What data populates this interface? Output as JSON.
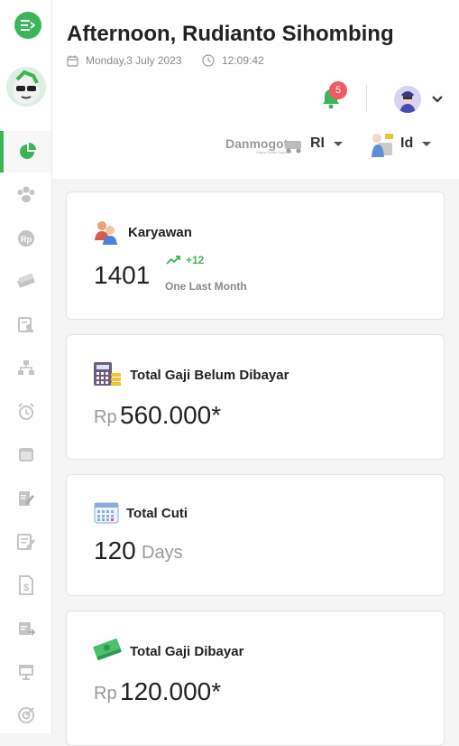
{
  "header": {
    "greeting": "Afternoon, Rudianto Sihombing",
    "date": "Monday,3 July 2023",
    "time": "12:09:42",
    "notification_count": "5",
    "brand_name": "Danmogot",
    "region_code": "RI",
    "language_code": "Id"
  },
  "sidebar": {
    "items": [
      {
        "icon": "pie-chart-icon",
        "active": true
      },
      {
        "icon": "users-icon"
      },
      {
        "icon": "rupiah-icon"
      },
      {
        "icon": "money-icon"
      },
      {
        "icon": "employee-card-icon"
      },
      {
        "icon": "org-chart-icon"
      },
      {
        "icon": "alarm-clock-icon"
      },
      {
        "icon": "calendar-icon"
      },
      {
        "icon": "edit-document-icon"
      },
      {
        "icon": "form-icon"
      },
      {
        "icon": "invoice-icon"
      },
      {
        "icon": "transfer-doc-icon"
      },
      {
        "icon": "presentation-icon"
      },
      {
        "icon": "target-icon"
      }
    ]
  },
  "cards": {
    "employees": {
      "title": "Karyawan",
      "value": "1401",
      "trend": "+12",
      "trend_label": "One Last Month"
    },
    "unpaid_salary": {
      "title": "Total Gaji Belum Dibayar",
      "currency": "Rp",
      "value": "560.000*"
    },
    "leave": {
      "title": "Total Cuti",
      "value": "120",
      "unit": "Days"
    },
    "paid_salary": {
      "title": "Total Gaji Dibayar",
      "currency": "Rp",
      "value": "120.000*"
    }
  },
  "colors": {
    "accent": "#3cb45a",
    "badge": "#ef5b62"
  }
}
